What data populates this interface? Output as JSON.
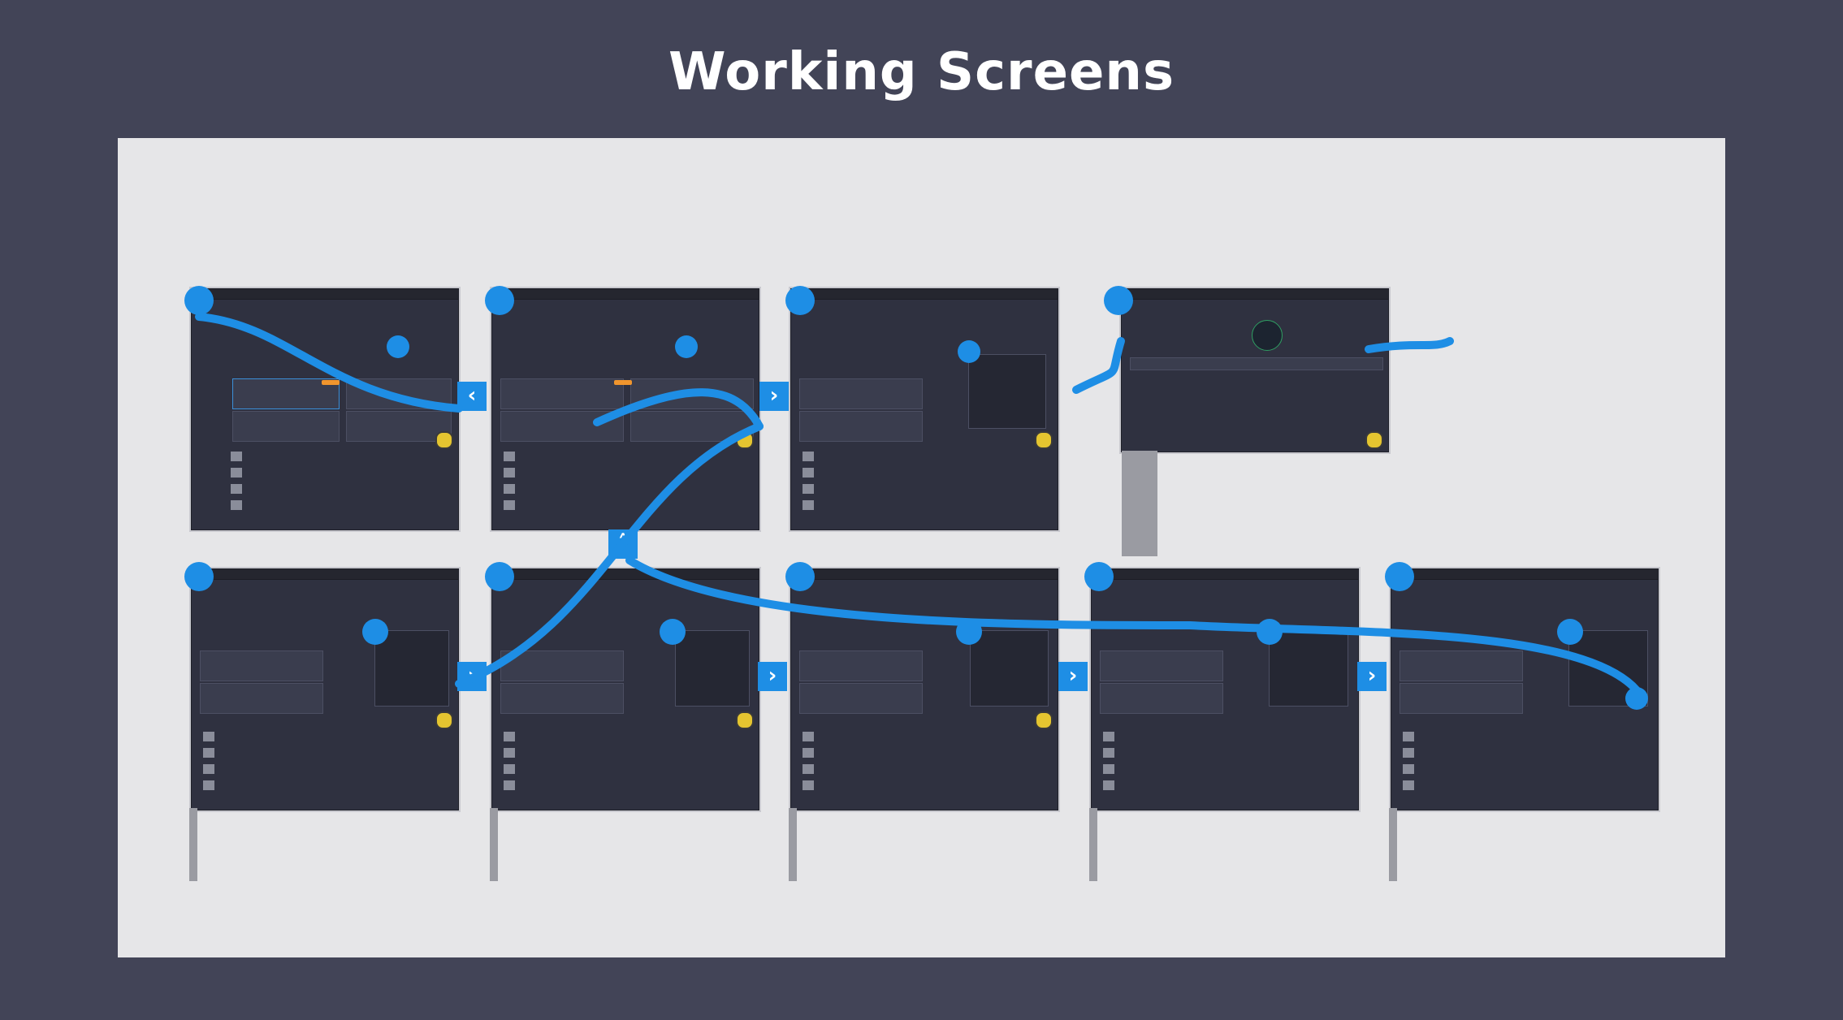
{
  "page": {
    "title": "Working Screens"
  },
  "colors": {
    "background": "#424457",
    "canvas": "#e6e6e8",
    "screen": "#2f3140",
    "connector": "#1e8ee5",
    "accent": "#f0952d"
  },
  "icons": {
    "pin": "pin-icon",
    "hand": "hand-pointer-icon",
    "nav_left": "chevron-left-icon",
    "nav_right": "chevron-right-icon",
    "nav_up": "chevron-up-icon"
  }
}
